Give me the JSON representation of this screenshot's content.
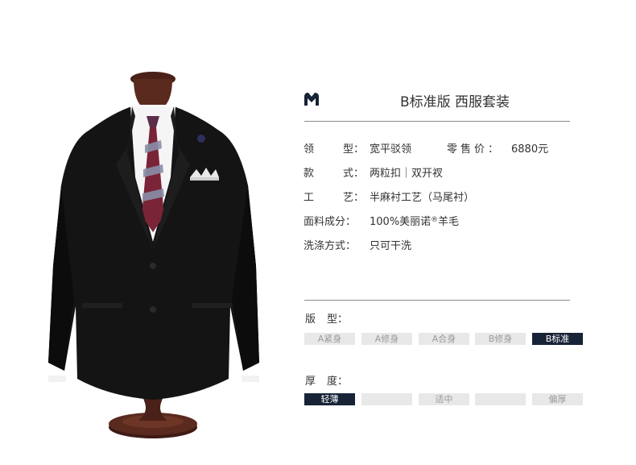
{
  "product": {
    "title": "B标准版 西服套装",
    "image_description_icon": "suit-on-mannequin-image",
    "logo_icon": "brand-crown-logo-icon"
  },
  "specs": {
    "collar": {
      "label_chars": [
        "领",
        "型"
      ],
      "value": "宽平驳领"
    },
    "price": {
      "label": "零售价：",
      "value": "6880元"
    },
    "style": {
      "label_chars": [
        "款",
        "式"
      ],
      "value": "两粒扣｜双开衩"
    },
    "craft": {
      "label_chars": [
        "工",
        "艺"
      ],
      "value": "半麻衬工艺（马尾衬）"
    },
    "fabric": {
      "label": "面料成分：",
      "value_prefix": "100%美丽诺",
      "value_reg": "®",
      "value_suffix": "羊毛"
    },
    "wash": {
      "label": "洗涤方式：",
      "value": "只可干洗"
    }
  },
  "fit": {
    "label_chars": [
      "版",
      "型："
    ],
    "options": [
      "A紧身",
      "A修身",
      "A合身",
      "B修身",
      "B标准"
    ],
    "selected_index": 4
  },
  "thickness": {
    "label_chars": [
      "厚",
      "度："
    ],
    "options": [
      "轻薄",
      "",
      "适中",
      "",
      "偏厚"
    ],
    "selected_index": 0
  },
  "colors": {
    "selected_bg": "#172336",
    "unselected_bg": "#e8e8e8",
    "unselected_text": "#9a9a9a",
    "divider": "#8a8a8a"
  }
}
